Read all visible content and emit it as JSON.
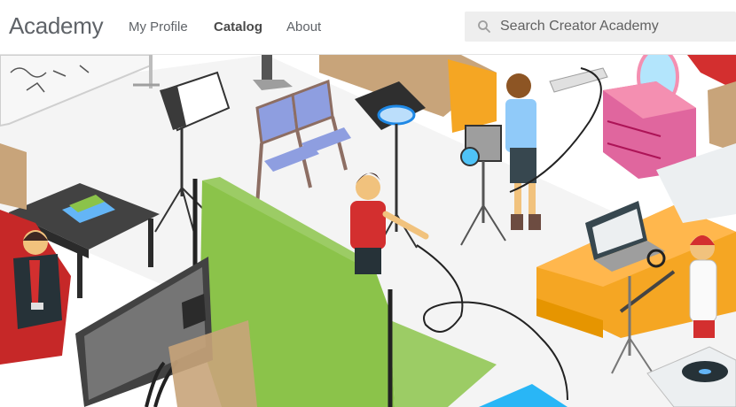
{
  "header": {
    "logo": "Academy",
    "nav": [
      {
        "label": "My Profile"
      },
      {
        "label": "Catalog",
        "active": true
      },
      {
        "label": "About"
      }
    ],
    "search": {
      "placeholder": "Search Creator Academy",
      "value": ""
    }
  },
  "icons": {
    "search": "search-icon"
  },
  "colors": {
    "header_bg": "#ffffff",
    "search_bg": "#eeeeee",
    "text": "#5f6368",
    "green_screen": "#8bc34a",
    "bed": "#f5a623",
    "dresser": "#e0669e"
  }
}
